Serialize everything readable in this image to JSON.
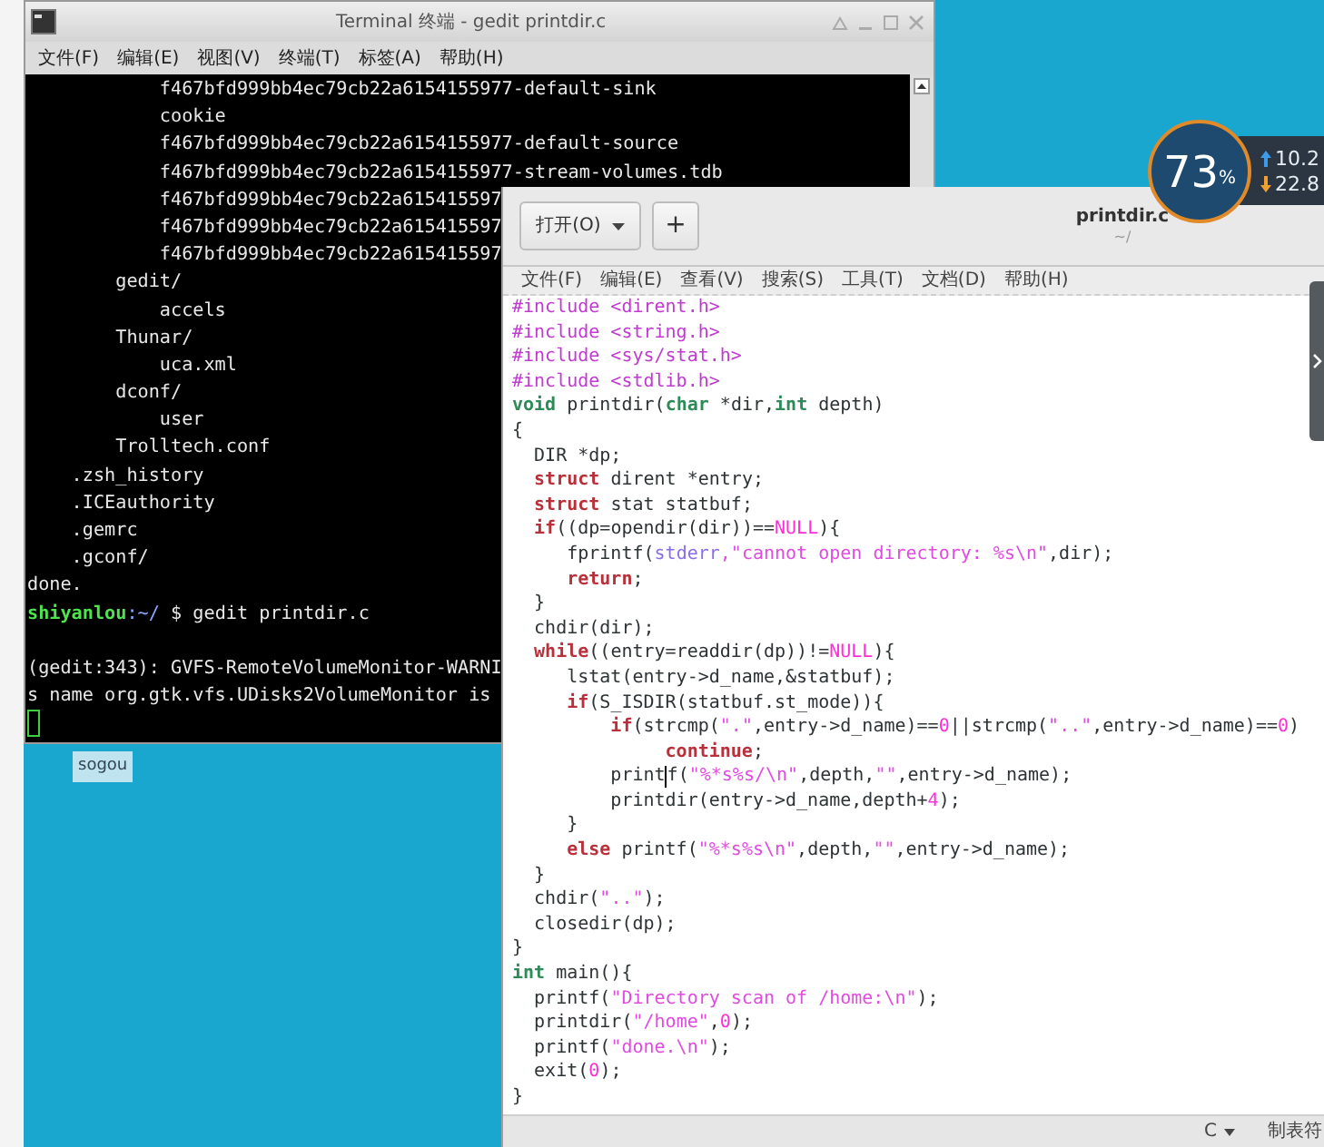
{
  "terminal": {
    "title": "Terminal 终端 - gedit printdir.c",
    "menu": [
      "文件(F)",
      "编辑(E)",
      "视图(V)",
      "终端(T)",
      "标签(A)",
      "帮助(H)"
    ],
    "lines": [
      {
        "kind": "text",
        "text": "            f467bfd999bb4ec79cb22a6154155977-default-sink"
      },
      {
        "kind": "text",
        "text": "            cookie"
      },
      {
        "kind": "text",
        "text": "            f467bfd999bb4ec79cb22a6154155977-default-source"
      },
      {
        "kind": "text",
        "text": "            f467bfd999bb4ec79cb22a6154155977-stream-volumes.tdb"
      },
      {
        "kind": "text",
        "text": "            f467bfd999bb4ec79cb22a615415597"
      },
      {
        "kind": "text",
        "text": "            f467bfd999bb4ec79cb22a615415597"
      },
      {
        "kind": "text",
        "text": "            f467bfd999bb4ec79cb22a615415597"
      },
      {
        "kind": "text",
        "text": "        gedit/"
      },
      {
        "kind": "text",
        "text": "            accels"
      },
      {
        "kind": "text",
        "text": "        Thunar/"
      },
      {
        "kind": "text",
        "text": "            uca.xml"
      },
      {
        "kind": "text",
        "text": "        dconf/"
      },
      {
        "kind": "text",
        "text": "            user"
      },
      {
        "kind": "text",
        "text": "        Trolltech.conf"
      },
      {
        "kind": "text",
        "text": "    .zsh_history"
      },
      {
        "kind": "text",
        "text": "    .ICEauthority"
      },
      {
        "kind": "text",
        "text": "    .gemrc"
      },
      {
        "kind": "text",
        "text": "    .gconf/"
      },
      {
        "kind": "text",
        "text": "done."
      },
      {
        "kind": "prompt",
        "user": "shiyanlou",
        "path": ":~/",
        "command": " $ gedit printdir.c"
      },
      {
        "kind": "blank"
      },
      {
        "kind": "text",
        "text": "(gedit:343): GVFS-RemoteVolumeMonitor-WARNI"
      },
      {
        "kind": "text",
        "text": "s name org.gtk.vfs.UDisks2VolumeMonitor is"
      },
      {
        "kind": "cursor"
      }
    ]
  },
  "ime_indicator": {
    "label": "sogou"
  },
  "gedit": {
    "open_button": {
      "label": "打开(O)"
    },
    "new_tab_button": {
      "label": "+"
    },
    "title": "printdir.c",
    "subtitle": "~/",
    "menu": [
      "文件(F)",
      "编辑(E)",
      "查看(V)",
      "搜索(S)",
      "工具(T)",
      "文档(D)",
      "帮助(H)"
    ],
    "code": [
      [
        {
          "kind": "preproc",
          "text": "#include <dirent.h>"
        }
      ],
      [
        {
          "kind": "preproc",
          "text": "#include <string.h>"
        }
      ],
      [
        {
          "kind": "preproc",
          "text": "#include <sys/stat.h>"
        }
      ],
      [
        {
          "kind": "preproc",
          "text": "#include <stdlib.h>"
        }
      ],
      [
        {
          "kind": "type",
          "text": "void"
        },
        {
          "kind": "plain",
          "text": " printdir("
        },
        {
          "kind": "type",
          "text": "char"
        },
        {
          "kind": "plain",
          "text": " *dir,"
        },
        {
          "kind": "type",
          "text": "int"
        },
        {
          "kind": "plain",
          "text": " depth)"
        }
      ],
      [
        {
          "kind": "plain",
          "text": "{"
        }
      ],
      [
        {
          "kind": "plain",
          "text": "  DIR *dp;"
        }
      ],
      [
        {
          "kind": "keyword",
          "text": "  struct"
        },
        {
          "kind": "plain",
          "text": " dirent *entry;"
        }
      ],
      [
        {
          "kind": "keyword",
          "text": "  struct"
        },
        {
          "kind": "plain",
          "text": " stat statbuf;"
        }
      ],
      [
        {
          "kind": "keyword",
          "text": "  if"
        },
        {
          "kind": "plain",
          "text": "((dp=opendir(dir))=="
        },
        {
          "kind": "constant",
          "text": "NULL"
        },
        {
          "kind": "plain",
          "text": "){"
        }
      ],
      [
        {
          "kind": "plain",
          "text": "     fprintf("
        },
        {
          "kind": "builtin",
          "text": "stderr"
        },
        {
          "kind": "string",
          "text": ",\"cannot open directory: %s\\n\""
        },
        {
          "kind": "plain",
          "text": ",dir);"
        }
      ],
      [
        {
          "kind": "keyword",
          "text": "     return"
        },
        {
          "kind": "plain",
          "text": ";"
        }
      ],
      [
        {
          "kind": "plain",
          "text": "  }"
        }
      ],
      [
        {
          "kind": "plain",
          "text": "  chdir(dir);"
        }
      ],
      [
        {
          "kind": "keyword",
          "text": "  while"
        },
        {
          "kind": "plain",
          "text": "((entry=readdir(dp))!="
        },
        {
          "kind": "constant",
          "text": "NULL"
        },
        {
          "kind": "plain",
          "text": "){"
        }
      ],
      [
        {
          "kind": "plain",
          "text": "     lstat(entry->d_name,&statbuf);"
        }
      ],
      [
        {
          "kind": "keyword",
          "text": "     if"
        },
        {
          "kind": "plain",
          "text": "(S_ISDIR(statbuf.st_mode)){"
        }
      ],
      [
        {
          "kind": "keyword",
          "text": "         if"
        },
        {
          "kind": "plain",
          "text": "(strcmp("
        },
        {
          "kind": "string",
          "text": "\".\""
        },
        {
          "kind": "plain",
          "text": ",entry->d_name)=="
        },
        {
          "kind": "constant",
          "text": "0"
        },
        {
          "kind": "plain",
          "text": "||strcmp("
        },
        {
          "kind": "string",
          "text": "\"..\""
        },
        {
          "kind": "plain",
          "text": ",entry->d_name)=="
        },
        {
          "kind": "constant",
          "text": "0"
        },
        {
          "kind": "plain",
          "text": ")"
        }
      ],
      [
        {
          "kind": "keyword",
          "text": "              continue"
        },
        {
          "kind": "plain",
          "text": ";"
        }
      ],
      [
        {
          "kind": "plain",
          "text": "         print"
        },
        {
          "kind": "caret"
        },
        {
          "kind": "plain",
          "text": "f("
        },
        {
          "kind": "string",
          "text": "\"%*s%s/\\n\""
        },
        {
          "kind": "plain",
          "text": ",depth,"
        },
        {
          "kind": "string",
          "text": "\"\""
        },
        {
          "kind": "plain",
          "text": ",entry->d_name);"
        }
      ],
      [
        {
          "kind": "plain",
          "text": "         printdir(entry->d_name,depth+"
        },
        {
          "kind": "constant",
          "text": "4"
        },
        {
          "kind": "plain",
          "text": ");"
        }
      ],
      [
        {
          "kind": "plain",
          "text": "     }"
        }
      ],
      [
        {
          "kind": "keyword",
          "text": "     else"
        },
        {
          "kind": "plain",
          "text": " printf("
        },
        {
          "kind": "string",
          "text": "\"%*s%s\\n\""
        },
        {
          "kind": "plain",
          "text": ",depth,"
        },
        {
          "kind": "string",
          "text": "\"\""
        },
        {
          "kind": "plain",
          "text": ",entry->d_name);"
        }
      ],
      [
        {
          "kind": "plain",
          "text": "  }"
        }
      ],
      [
        {
          "kind": "plain",
          "text": "  chdir("
        },
        {
          "kind": "string",
          "text": "\"..\""
        },
        {
          "kind": "plain",
          "text": ");"
        }
      ],
      [
        {
          "kind": "plain",
          "text": "  closedir(dp);"
        }
      ],
      [
        {
          "kind": "plain",
          "text": "}"
        }
      ],
      [
        {
          "kind": "type",
          "text": "int"
        },
        {
          "kind": "plain",
          "text": " main(){"
        }
      ],
      [
        {
          "kind": "plain",
          "text": "  printf("
        },
        {
          "kind": "string",
          "text": "\"Directory scan of /home:\\n\""
        },
        {
          "kind": "plain",
          "text": ");"
        }
      ],
      [
        {
          "kind": "plain",
          "text": "  printdir("
        },
        {
          "kind": "string",
          "text": "\"/home\""
        },
        {
          "kind": "plain",
          "text": ","
        },
        {
          "kind": "constant",
          "text": "0"
        },
        {
          "kind": "plain",
          "text": ");"
        }
      ],
      [
        {
          "kind": "plain",
          "text": "  printf("
        },
        {
          "kind": "string",
          "text": "\"done.\\n\""
        },
        {
          "kind": "plain",
          "text": ");"
        }
      ],
      [
        {
          "kind": "plain",
          "text": "  exit("
        },
        {
          "kind": "constant",
          "text": "0"
        },
        {
          "kind": "plain",
          "text": ");"
        }
      ],
      [
        {
          "kind": "plain",
          "text": "}"
        }
      ]
    ],
    "status": {
      "language": "C",
      "tab_width": "制表符"
    }
  },
  "monitor_widget": {
    "percent": "73",
    "percent_sign": "%",
    "upload": "10.2",
    "download": "22.8"
  }
}
